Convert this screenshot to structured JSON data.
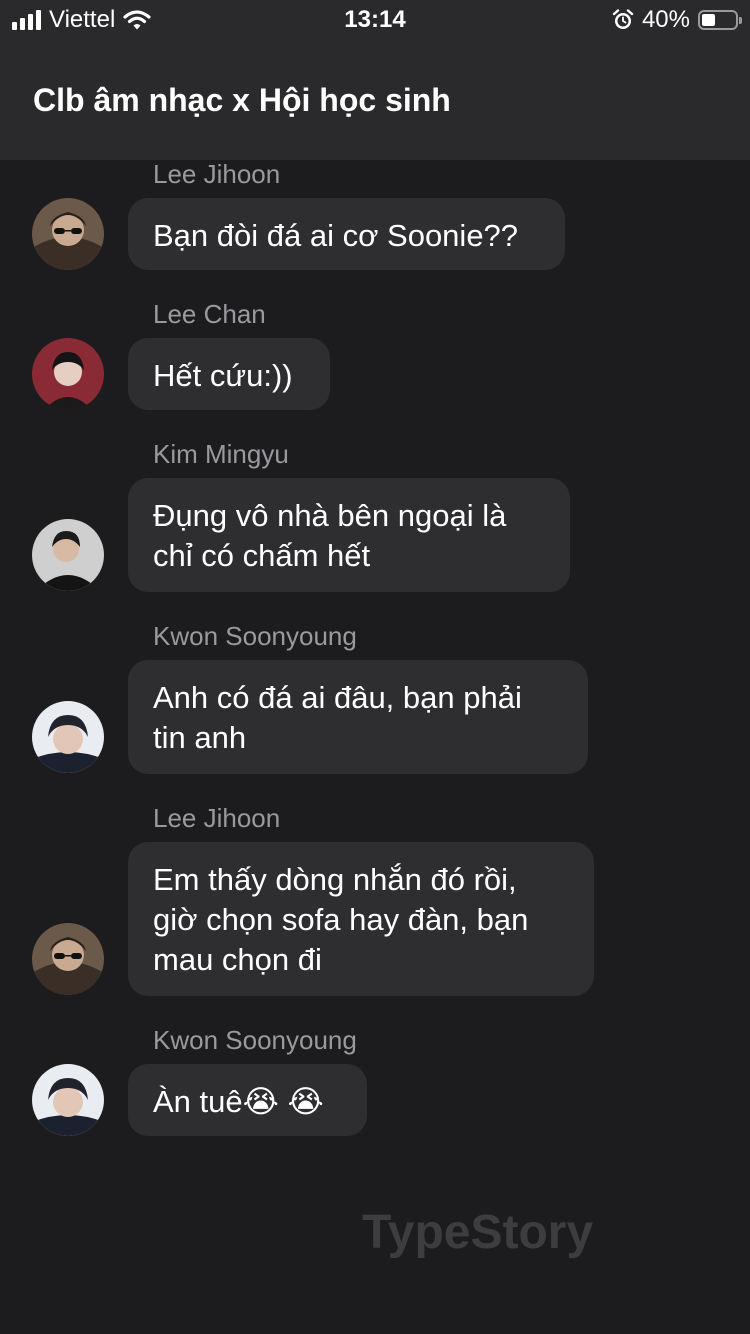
{
  "status_bar": {
    "carrier": "Viettel",
    "time": "13:14",
    "battery_percent": "40%",
    "battery_level": 0.4,
    "icons": [
      "signal-icon",
      "wifi-icon",
      "alarm-icon",
      "battery-icon"
    ]
  },
  "header": {
    "title": "Clb âm nhạc x Hội học sinh"
  },
  "messages": [
    {
      "sender": "Lee Jihoon",
      "text": "Bạn đòi đá ai cơ Soonie??",
      "avatar": "avatar-lee-jihoon"
    },
    {
      "sender": "Lee Chan",
      "text": "Hết cứu:))",
      "avatar": "avatar-lee-chan"
    },
    {
      "sender": "Kim Mingyu",
      "text": "Đụng vô nhà bên ngoại là\nchỉ có chấm hết",
      "avatar": "avatar-kim-mingyu"
    },
    {
      "sender": "Kwon Soonyoung",
      "text": "Anh có đá ai đâu, bạn phải\ntin anh",
      "avatar": "avatar-kwon-soonyoung"
    },
    {
      "sender": "Lee Jihoon",
      "text": "Em thấy dòng nhắn đó rồi,\ngiờ chọn sofa hay đàn, bạn\nmau chọn đi",
      "avatar": "avatar-lee-jihoon"
    },
    {
      "sender": "Kwon Soonyoung",
      "text": "Àn tuê😭 😭",
      "avatar": "avatar-kwon-soonyoung"
    }
  ],
  "watermark": "TypeStory",
  "colors": {
    "background": "#1c1c1e",
    "header": "#2a2a2c",
    "bubble": "#2e2e31",
    "sender_name": "#9a9a9e",
    "watermark": "#3d3d40"
  }
}
